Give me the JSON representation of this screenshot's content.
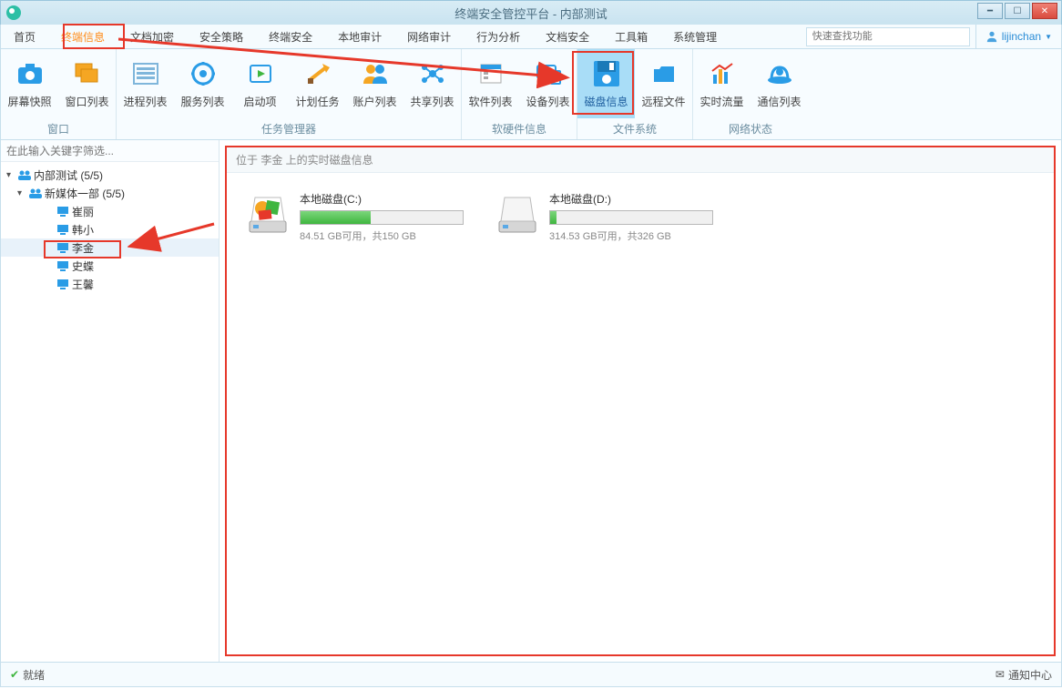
{
  "window": {
    "title": "终端安全管控平台 - 内部测试"
  },
  "menu": {
    "items": [
      "首页",
      "终端信息",
      "文档加密",
      "安全策略",
      "终端安全",
      "本地审计",
      "网络审计",
      "行为分析",
      "文档安全",
      "工具箱",
      "系统管理"
    ],
    "active_index": 1,
    "search_placeholder": "快速查找功能",
    "user_name": "lijinchan"
  },
  "ribbon": {
    "groups": [
      {
        "label": "窗口",
        "items": [
          {
            "name": "屏幕快照",
            "icon": "camera"
          },
          {
            "name": "窗口列表",
            "icon": "windows"
          }
        ]
      },
      {
        "label": "任务管理器",
        "items": [
          {
            "name": "进程列表",
            "icon": "process"
          },
          {
            "name": "服务列表",
            "icon": "service"
          },
          {
            "name": "启动项",
            "icon": "startup"
          },
          {
            "name": "计划任务",
            "icon": "schedule"
          },
          {
            "name": "账户列表",
            "icon": "accounts"
          },
          {
            "name": "共享列表",
            "icon": "share"
          }
        ]
      },
      {
        "label": "软硬件信息",
        "items": [
          {
            "name": "软件列表",
            "icon": "software"
          },
          {
            "name": "设备列表",
            "icon": "devices"
          }
        ]
      },
      {
        "label": "文件系统",
        "items": [
          {
            "name": "磁盘信息",
            "icon": "disk",
            "selected": true
          },
          {
            "name": "远程文件",
            "icon": "remote-file"
          }
        ]
      },
      {
        "label": "网络状态",
        "items": [
          {
            "name": "实时流量",
            "icon": "traffic"
          },
          {
            "name": "通信列表",
            "icon": "comm"
          }
        ]
      }
    ]
  },
  "sidebar": {
    "filter_placeholder": "在此输入关键字筛选...",
    "tree": {
      "root": {
        "label": "内部测试 (5/5)"
      },
      "group": {
        "label": "新媒体一部 (5/5)"
      },
      "members": [
        "崔丽",
        "韩小",
        "李金",
        "史蝶",
        "王馨"
      ],
      "selected_index": 2
    }
  },
  "content": {
    "header": "位于 李金 上的实时磁盘信息",
    "disks": [
      {
        "name": "本地磁盘(C:)",
        "usage_text": "84.51 GB可用，共150 GB",
        "used_pct": 43
      },
      {
        "name": "本地磁盘(D:)",
        "usage_text": "314.53 GB可用，共326 GB",
        "used_pct": 4
      }
    ]
  },
  "status": {
    "ready": "就绪",
    "notify": "通知中心"
  }
}
